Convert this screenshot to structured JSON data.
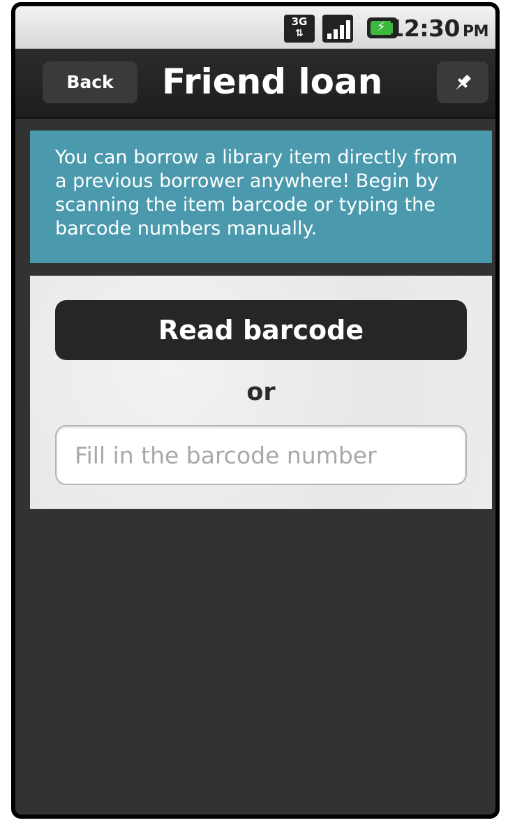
{
  "status_bar": {
    "network_type": "3G",
    "time": "12:30",
    "ampm": "PM",
    "icons": [
      "network-3g-icon",
      "signal-strength-icon",
      "battery-charging-icon"
    ]
  },
  "header": {
    "back_label": "Back",
    "title": "Friend loan",
    "pin_icon": "pin-icon"
  },
  "info_banner": {
    "text": "You can borrow a library item directly from a previous borrower anywhere! Begin by scanning the item barcode or typing the barcode numbers manually."
  },
  "main": {
    "read_barcode_label": "Read barcode",
    "separator_text": "or",
    "barcode_input": {
      "value": "",
      "placeholder": "Fill in the barcode number"
    }
  },
  "colors": {
    "banner": "#4a99ad",
    "background": "#323232",
    "button_dark": "#262626",
    "battery": "#3cb83c"
  }
}
